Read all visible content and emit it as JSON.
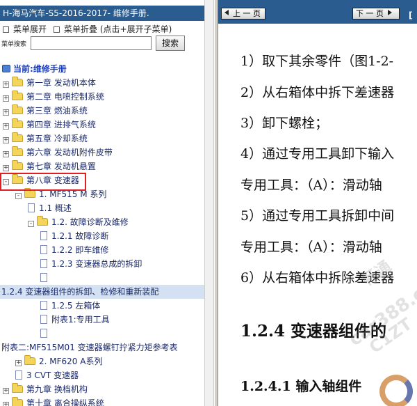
{
  "left_pane": {
    "doc_title": "H-海马汽车-S5-2016-2017- 维修手册.",
    "expand_all": "菜单展开",
    "collapse_all": "菜单折叠 (点击+展开子菜单)",
    "search_label": "菜单搜索",
    "search_placeholder": "",
    "search_button": "搜索",
    "current_label": "当前:维修手册",
    "tree": [
      {
        "label": "第一章 发动机本体",
        "kind": "folder",
        "expander": "+",
        "level": 0
      },
      {
        "label": "第二章 电喷控制系统",
        "kind": "folder",
        "expander": "+",
        "level": 0
      },
      {
        "label": "第三章 燃油系统",
        "kind": "folder",
        "expander": "+",
        "level": 0
      },
      {
        "label": "第四章 进排气系统",
        "kind": "folder",
        "expander": "+",
        "level": 0
      },
      {
        "label": "第五章 冷却系统",
        "kind": "folder",
        "expander": "+",
        "level": 0
      },
      {
        "label": "第六章 发动机附件皮带",
        "kind": "folder",
        "expander": "+",
        "level": 0
      },
      {
        "label": "第七章 发动机悬置",
        "kind": "folder",
        "expander": "+",
        "level": 0
      },
      {
        "label": "第八章 变速器",
        "kind": "folder",
        "expander": "-",
        "level": 0,
        "boxed": true
      },
      {
        "label": "1. MF515 M 系列",
        "kind": "folder",
        "expander": "-",
        "level": 1
      },
      {
        "label": "1.1 概述",
        "kind": "page",
        "expander": "",
        "level": 2
      },
      {
        "label": "1.2. 故障诊断及维修",
        "kind": "folder",
        "expander": "-",
        "level": 2
      },
      {
        "label": "1.2.1 故障诊断",
        "kind": "page",
        "expander": "",
        "level": 3
      },
      {
        "label": "1.2.2 即车维修",
        "kind": "page",
        "expander": "",
        "level": 3
      },
      {
        "label": "1.2.3 变速器总成的拆卸",
        "kind": "page",
        "expander": "",
        "level": 3
      },
      {
        "label": "",
        "kind": "page",
        "expander": "",
        "level": 3
      },
      {
        "label": "1.2.4 变速器组件的拆卸、检修和重新装配",
        "kind": "text",
        "expander": "",
        "level": 0,
        "selected": true
      },
      {
        "label": "1.2.5 左箱体",
        "kind": "page",
        "expander": "",
        "level": 3
      },
      {
        "label": "附表1:专用工具",
        "kind": "page",
        "expander": "",
        "level": 3
      },
      {
        "label": "",
        "kind": "page",
        "expander": "",
        "level": 3
      },
      {
        "label": "附表二:MF515M01 变速器螺钉拧紧力矩参考表",
        "kind": "text",
        "expander": "",
        "level": 0
      },
      {
        "label": "2. MF620 A系列",
        "kind": "folder",
        "expander": "+",
        "level": 1
      },
      {
        "label": "3 CVT 变速器",
        "kind": "page",
        "expander": "",
        "level": 1
      },
      {
        "label": "第九章 换档机构",
        "kind": "folder",
        "expander": "+",
        "level": 0
      },
      {
        "label": "第十章 离合操纵系统",
        "kind": "folder",
        "expander": "+",
        "level": 0
      }
    ]
  },
  "right_pane": {
    "prev_label": "上 一 页",
    "next_label": "下 一 页",
    "corner_tag": "[",
    "lines": [
      "1）取下其余零件（图1-2-",
      "2）从右箱体中拆下差速器",
      "3）卸下螺栓；",
      "4）通过专用工具卸下输入",
      "专用工具：（A）：滑动轴",
      "5）通过专用工具拆卸中间",
      "专用工具：（A）：滑动轴",
      "6）从右箱体中拆除差速器"
    ],
    "heading_2": "1.2.4 变速器组件的",
    "heading_3": "1.2.4.1 输入轴组件",
    "watermark_1": "畅通",
    "watermark_2": "car388.c",
    "watermark_3": "C1ZT"
  }
}
